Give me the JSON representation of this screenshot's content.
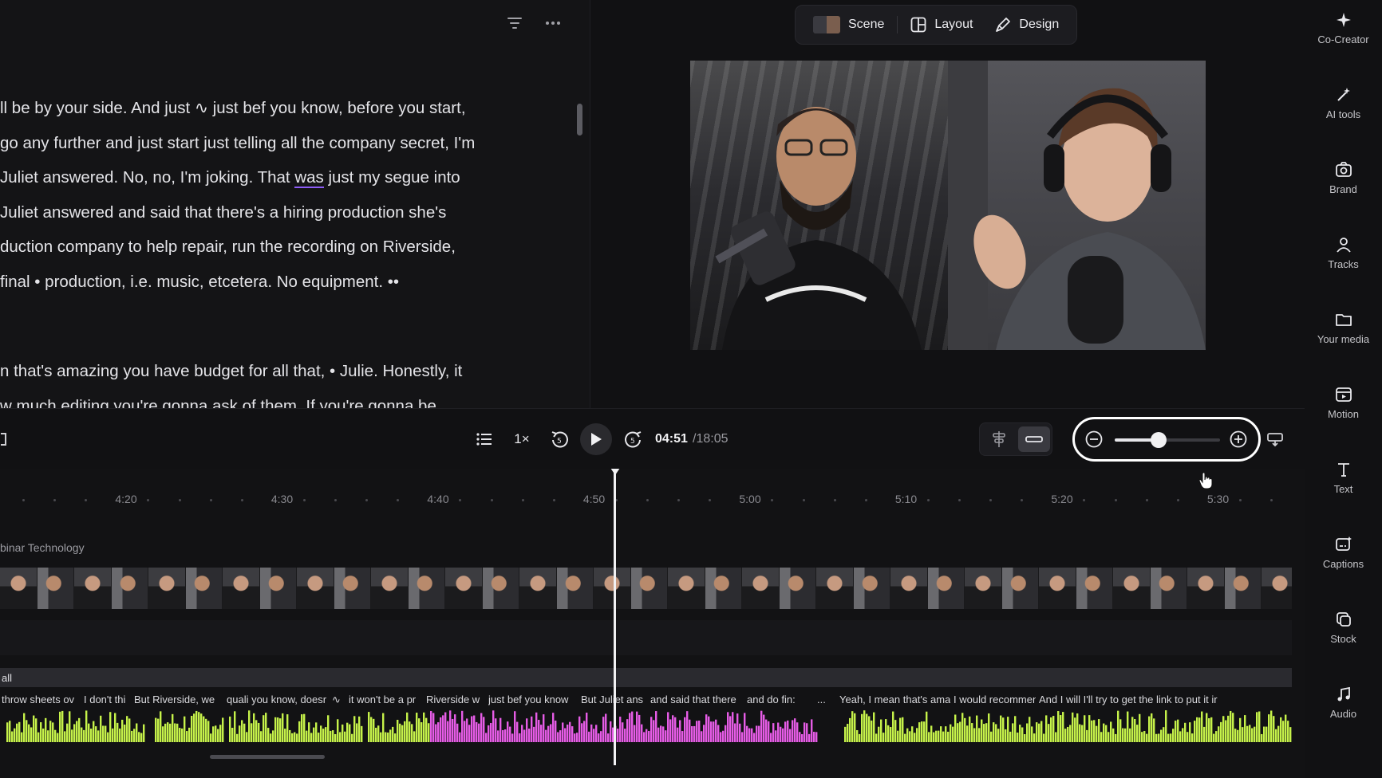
{
  "transcript": {
    "lines": [
      "ll be by your side. And just ∿ just bef you know, before you start,",
      "go any further and just start just telling all the company secret, I'm",
      " Juliet answered. No, no, I'm joking. That ",
      "Juliet answered and said that there's a hiring production she's",
      "duction company to help repair, run the recording on Riverside,",
      "final • production, i.e. music, etcetera. No equipment. ••",
      "n that's amazing you have budget for all that, • Julie. Honestly, it",
      "w much editing you're gonna ask of them. If you're gonna be"
    ],
    "highlight_word": "was",
    "line3_tail": " just my segue into",
    "filter_icon": "filter-icon",
    "more_icon": "more-icon"
  },
  "preview": {
    "segments": [
      {
        "label": "Scene",
        "icon": "scene-thumbnail"
      },
      {
        "label": "Layout",
        "icon": "layout-icon"
      },
      {
        "label": "Design",
        "icon": "brush-icon"
      }
    ]
  },
  "sidebar": {
    "items": [
      {
        "label": "Co-Creator",
        "icon": "sparkle-icon"
      },
      {
        "label": "AI tools",
        "icon": "magic-wand-icon"
      },
      {
        "label": "Brand",
        "icon": "brand-kit-icon"
      },
      {
        "label": "Tracks",
        "icon": "people-icon"
      },
      {
        "label": "Your media",
        "icon": "folder-icon"
      },
      {
        "label": "Motion",
        "icon": "motion-icon"
      },
      {
        "label": "Text",
        "icon": "text-icon"
      },
      {
        "label": "Captions",
        "icon": "captions-icon"
      },
      {
        "label": "Stock",
        "icon": "stock-icon"
      },
      {
        "label": "Audio",
        "icon": "music-note-icon"
      }
    ]
  },
  "transport": {
    "speed": "1×",
    "skip_back_label": "5",
    "skip_forward_label": "5",
    "current_time": "04:51",
    "total_time": "/18:05",
    "zoom_level": 0.42
  },
  "timeline": {
    "ticks": [
      "4:20",
      "4:30",
      "4:40",
      "4:50",
      "5:00",
      "5:10",
      "5:20",
      "5:30"
    ],
    "video_track_name": "binar Technology",
    "audio_track_name": "all",
    "captions": [
      "throw sheets ov",
      "I don't thi",
      "But Riverside, we",
      "quali you know, doesr",
      "∿",
      "it won't be a pr",
      "Riverside w",
      "just bef you know",
      "But Juliet ans",
      "and said that there",
      "and do fin:",
      "...",
      "Yeah, I mean that's amazing yo",
      "I would recommen",
      "And I will I'll try to get the link to put it ir"
    ],
    "colors": {
      "speaker_a": "#c6f24a",
      "speaker_b": "#e65ce6",
      "playhead": "#f2f2f4"
    }
  }
}
